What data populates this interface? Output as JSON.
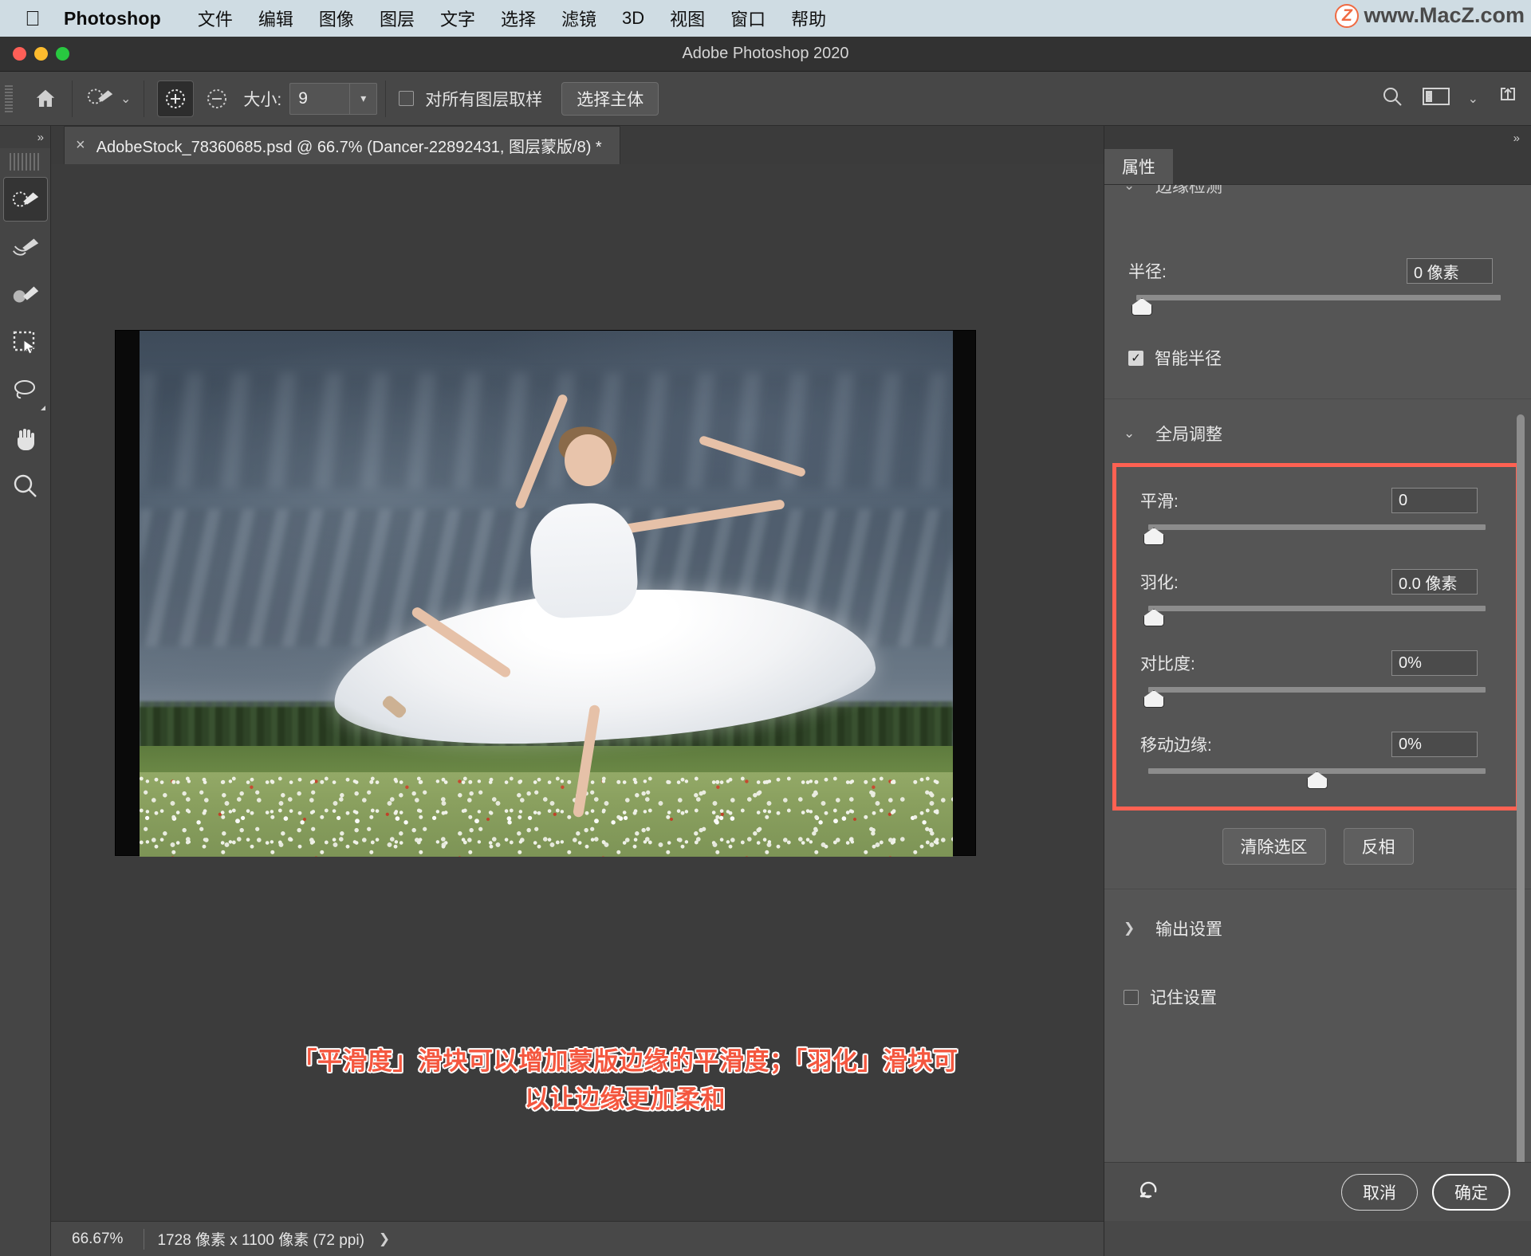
{
  "macmenu": {
    "apple_icon": "apple-logo",
    "app_name": "Photoshop",
    "items": [
      "文件",
      "编辑",
      "图像",
      "图层",
      "文字",
      "选择",
      "滤镜",
      "3D",
      "视图",
      "窗口",
      "帮助"
    ],
    "watermark_badge": "Z",
    "watermark_text": "www.MacZ.com"
  },
  "titlebar": {
    "title": "Adobe Photoshop 2020"
  },
  "options": {
    "home_icon": "home-icon",
    "brush_icon": "brush-preset-icon",
    "caret": "⌄",
    "add_icon": "add-to-selection-icon",
    "subtract_icon": "subtract-from-selection-icon",
    "size_label": "大小:",
    "size_value": "9",
    "sample_all_layers_label": "对所有图层取样",
    "sample_all_layers_checked": false,
    "select_subject_label": "选择主体",
    "search_icon": "search-icon",
    "workspace_icon": "workspace-switcher-icon",
    "share_icon": "share-icon"
  },
  "toolbar": {
    "collapse_icon": "expand-panel-icon",
    "tools": [
      {
        "name": "quick-selection-tool",
        "glyph": "brush-select",
        "active": true
      },
      {
        "name": "refine-edge-brush-tool",
        "glyph": "refine-brush",
        "active": false
      },
      {
        "name": "brush-tool",
        "glyph": "brush-dot",
        "active": false
      },
      {
        "name": "object-selection-tool",
        "glyph": "marquee-arrow",
        "active": false
      },
      {
        "name": "lasso-tool",
        "glyph": "lasso",
        "active": false
      },
      {
        "name": "hand-tool",
        "glyph": "hand",
        "active": false
      },
      {
        "name": "zoom-tool",
        "glyph": "magnifier",
        "active": false
      }
    ]
  },
  "document": {
    "close_icon": "close-tab-icon",
    "tab_title": "AdobeStock_78360685.psd @ 66.7% (Dancer-22892431, 图层蒙版/8) *"
  },
  "annotation": {
    "line1": "「平滑度」滑块可以增加蒙版边缘的平滑度；「羽化」滑块可",
    "line2": "以让边缘更加柔和",
    "color": "#f4573f"
  },
  "statusbar": {
    "zoom": "66.67%",
    "dimensions": "1728 像素 x 1100 像素 (72 ppi)",
    "arrow": "❯"
  },
  "properties": {
    "collapse_icon": "expand-panel-icon",
    "tab_label": "属性",
    "edge_detection": {
      "chevron": "⌄",
      "title": "边缘检测",
      "radius_label": "半径:",
      "radius_value": "0 像素",
      "radius_knob_pct": 0,
      "smart_radius_label": "智能半径",
      "smart_radius_checked": true
    },
    "global_adjustments": {
      "chevron": "⌄",
      "title": "全局调整",
      "highlight_color": "#ff6152",
      "sliders": [
        {
          "label": "平滑:",
          "value": "0",
          "knob_pct": 0
        },
        {
          "label": "羽化:",
          "value": "0.0 像素",
          "knob_pct": 0
        },
        {
          "label": "对比度:",
          "value": "0%",
          "knob_pct": 0
        },
        {
          "label": "移动边缘:",
          "value": "0%",
          "knob_pct": 50
        }
      ],
      "clear_selection_label": "清除选区",
      "invert_label": "反相"
    },
    "output_settings": {
      "chevron": "❯",
      "title": "输出设置",
      "remember_label": "记住设置",
      "remember_checked": false
    },
    "footer": {
      "reset_icon": "reset-icon",
      "cancel_label": "取消",
      "ok_label": "确定"
    }
  }
}
